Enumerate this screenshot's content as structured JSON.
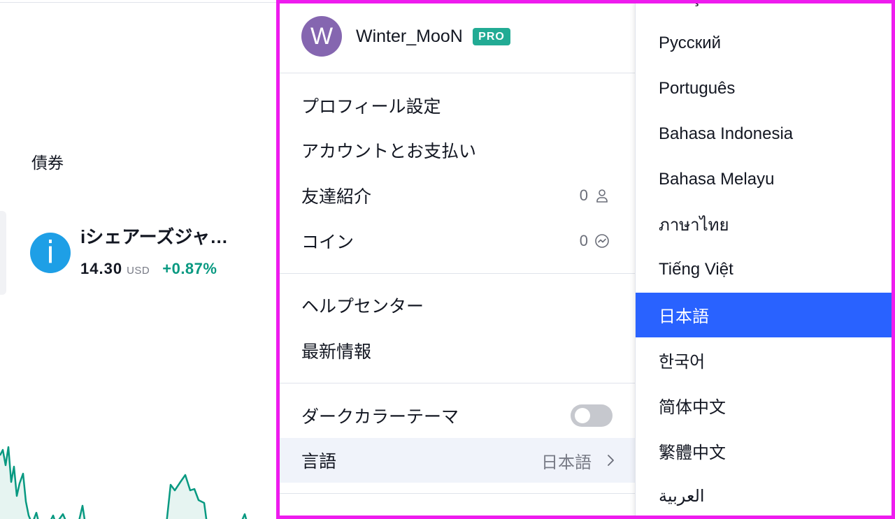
{
  "colors": {
    "accent": "#2962ff",
    "positive": "#089981",
    "pro_badge": "#22ab94",
    "avatar": "#8566b0",
    "info_icon": "#1e9fe6",
    "highlight_frame": "#ee1bee",
    "hover_row": "#f0f3fa"
  },
  "background_page": {
    "section_title": "債券",
    "instrument": {
      "logo_letter": "i",
      "logo_icon": "info-icon",
      "name": "iシェアーズジャ…",
      "price": "14.30",
      "currency": "USD",
      "change": "+0.87%"
    }
  },
  "user_menu": {
    "user": {
      "avatar_letter": "W",
      "name": "Winter_MooN",
      "badge": "PRO"
    },
    "items": {
      "profile_settings": {
        "label": "プロフィール設定"
      },
      "account_billing": {
        "label": "アカウントとお支払い"
      },
      "refer_friend": {
        "label": "友達紹介",
        "count": "0",
        "icon": "person-icon"
      },
      "coins": {
        "label": "コイン",
        "count": "0",
        "icon": "coin-icon"
      },
      "help_center": {
        "label": "ヘルプセンター"
      },
      "whats_new": {
        "label": "最新情報"
      },
      "dark_theme": {
        "label": "ダークカラーテーマ",
        "enabled": false
      },
      "language": {
        "label": "言語",
        "value": "日本語",
        "icon": "chevron-right-icon"
      }
    }
  },
  "language_menu": {
    "items": [
      {
        "label": "Türkçe"
      },
      {
        "label": "Русский"
      },
      {
        "label": "Português"
      },
      {
        "label": "Bahasa Indonesia"
      },
      {
        "label": "Bahasa Melayu"
      },
      {
        "label": "ภาษาไทย"
      },
      {
        "label": "Tiếng Việt"
      },
      {
        "label": "日本語",
        "selected": true
      },
      {
        "label": "한국어"
      },
      {
        "label": "简体中文"
      },
      {
        "label": "繁體中文"
      },
      {
        "label": "العربية"
      }
    ]
  }
}
